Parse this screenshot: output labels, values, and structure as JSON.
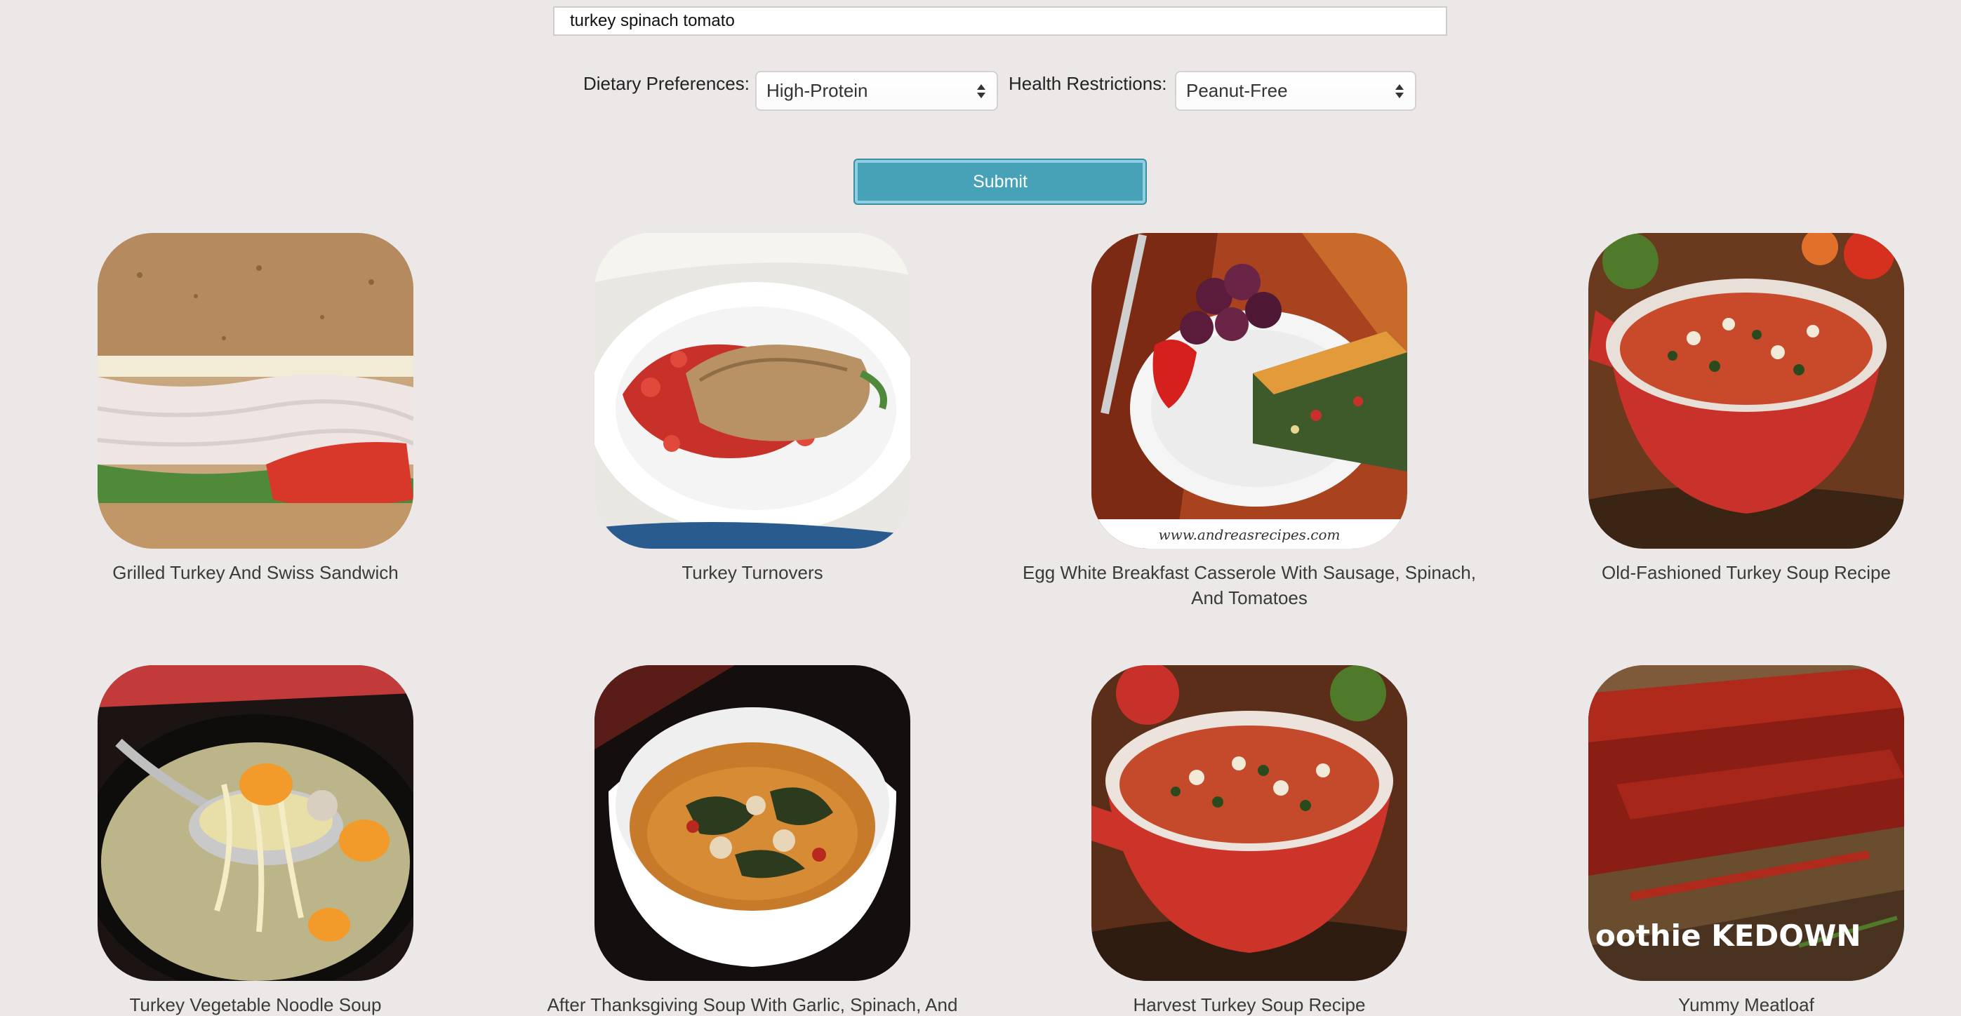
{
  "search": {
    "value": "turkey spinach tomato"
  },
  "filters": {
    "dietary_label": "Dietary Preferences:",
    "dietary_value": "High-Protein",
    "health_label": "Health Restrictions:",
    "health_value": "Peanut-Free"
  },
  "submit_label": "Submit",
  "recipes": [
    {
      "title": "Grilled Turkey And Swiss Sandwich"
    },
    {
      "title": "Turkey Turnovers"
    },
    {
      "title": "Egg White Breakfast Casserole With Sausage, Spinach, And Tomatoes",
      "image_text": "www.andreasrecipes.com"
    },
    {
      "title": "Old-Fashioned Turkey Soup Recipe"
    },
    {
      "title": "Turkey Vegetable Noodle Soup"
    },
    {
      "title": "After Thanksgiving Soup With Garlic, Spinach, And"
    },
    {
      "title": "Harvest Turkey Soup Recipe"
    },
    {
      "title": "Yummy Meatloaf",
      "image_text": "oothie KEDOWN"
    }
  ],
  "colors": {
    "background": "#ece8e7",
    "accent": "#47a2b8"
  }
}
